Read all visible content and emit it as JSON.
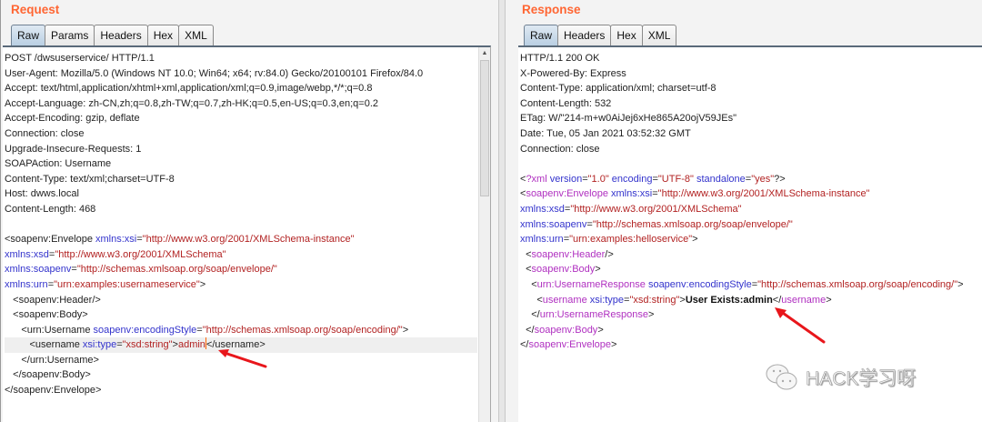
{
  "request": {
    "title": "Request",
    "tabs": [
      {
        "label": "Raw",
        "active": true
      },
      {
        "label": "Params"
      },
      {
        "label": "Headers"
      },
      {
        "label": "Hex"
      },
      {
        "label": "XML"
      }
    ],
    "lines": [
      [
        [
          "t",
          "POST /dwsuserservice/ HTTP/1.1"
        ]
      ],
      [
        [
          "t",
          "User-Agent: Mozilla/5.0 (Windows NT 10.0; Win64; x64; rv:84.0) Gecko/20100101 Firefox/84.0"
        ]
      ],
      [
        [
          "t",
          "Accept: text/html,application/xhtml+xml,application/xml;q=0.9,image/webp,*/*;q=0.8"
        ]
      ],
      [
        [
          "t",
          "Accept-Language: zh-CN,zh;q=0.8,zh-TW;q=0.7,zh-HK;q=0.5,en-US;q=0.3,en;q=0.2"
        ]
      ],
      [
        [
          "t",
          "Accept-Encoding: gzip, deflate"
        ]
      ],
      [
        [
          "t",
          "Connection: close"
        ]
      ],
      [
        [
          "t",
          "Upgrade-Insecure-Requests: 1"
        ]
      ],
      [
        [
          "t",
          "SOAPAction: Username"
        ]
      ],
      [
        [
          "t",
          "Content-Type: text/xml;charset=UTF-8"
        ]
      ],
      [
        [
          "t",
          "Host: dwws.local"
        ]
      ],
      [
        [
          "t",
          "Content-Length: 468"
        ]
      ],
      [
        [
          "t",
          ""
        ]
      ],
      [
        [
          "t",
          "<soapenv:Envelope "
        ],
        [
          "attr",
          "xmlns:xsi"
        ],
        [
          "t",
          "="
        ],
        [
          "val",
          "\"http://www.w3.org/2001/XMLSchema-instance\""
        ]
      ],
      [
        [
          "attr",
          "xmlns:xsd"
        ],
        [
          "t",
          "="
        ],
        [
          "val",
          "\"http://www.w3.org/2001/XMLSchema\""
        ]
      ],
      [
        [
          "attr",
          "xmlns:soapenv"
        ],
        [
          "t",
          "="
        ],
        [
          "val",
          "\"http://schemas.xmlsoap.org/soap/envelope/\""
        ]
      ],
      [
        [
          "attr",
          "xmlns:urn"
        ],
        [
          "t",
          "="
        ],
        [
          "val",
          "\"urn:examples:usernameservice\""
        ],
        [
          "t",
          ">"
        ]
      ],
      [
        [
          "t",
          "   <soapenv:Header/>"
        ]
      ],
      [
        [
          "t",
          "   <soapenv:Body>"
        ]
      ],
      [
        [
          "t",
          "      <urn:Username "
        ],
        [
          "attr",
          "soapenv:encodingStyle"
        ],
        [
          "t",
          "="
        ],
        [
          "val",
          "\"http://schemas.xmlsoap.org/soap/encoding/\""
        ],
        [
          "t",
          ">"
        ]
      ],
      [
        [
          "t",
          "         <username "
        ],
        [
          "attr",
          "xsi:type"
        ],
        [
          "t",
          "="
        ],
        [
          "val",
          "\"xsd:string\""
        ],
        [
          "t",
          ">"
        ],
        [
          "val",
          "admin"
        ],
        [
          "cursor",
          ""
        ],
        [
          "t",
          "</username>"
        ]
      ],
      [
        [
          "t",
          "      </urn:Username>"
        ]
      ],
      [
        [
          "t",
          "   </soapenv:Body>"
        ]
      ],
      [
        [
          "t",
          "</soapenv:Envelope>"
        ]
      ]
    ],
    "highlight_line": 19
  },
  "response": {
    "title": "Response",
    "tabs": [
      {
        "label": "Raw",
        "active": true
      },
      {
        "label": "Headers"
      },
      {
        "label": "Hex"
      },
      {
        "label": "XML"
      }
    ],
    "lines": [
      [
        [
          "t",
          "HTTP/1.1 200 OK"
        ]
      ],
      [
        [
          "t",
          "X-Powered-By: Express"
        ]
      ],
      [
        [
          "t",
          "Content-Type: application/xml; charset=utf-8"
        ]
      ],
      [
        [
          "t",
          "Content-Length: 532"
        ]
      ],
      [
        [
          "t",
          "ETag: W/\"214-m+w0AiJej6xHe865A20ojV59JEs\""
        ]
      ],
      [
        [
          "t",
          "Date: Tue, 05 Jan 2021 03:52:32 GMT"
        ]
      ],
      [
        [
          "t",
          "Connection: close"
        ]
      ],
      [
        [
          "t",
          ""
        ]
      ],
      [
        [
          "t",
          "<"
        ],
        [
          "tagp",
          "?xml"
        ],
        [
          "attr",
          " version"
        ],
        [
          "t",
          "="
        ],
        [
          "val",
          "\"1.0\""
        ],
        [
          "attr",
          " encoding"
        ],
        [
          "t",
          "="
        ],
        [
          "val",
          "\"UTF-8\""
        ],
        [
          "attr",
          " standalone"
        ],
        [
          "t",
          "="
        ],
        [
          "val",
          "\"yes\""
        ],
        [
          "t",
          "?>"
        ]
      ],
      [
        [
          "t",
          "<"
        ],
        [
          "tagp",
          "soapenv:Envelope"
        ],
        [
          "attr",
          " xmlns:xsi"
        ],
        [
          "t",
          "="
        ],
        [
          "val",
          "\"http://www.w3.org/2001/XMLSchema-instance\""
        ]
      ],
      [
        [
          "attr",
          "xmlns:xsd"
        ],
        [
          "t",
          "="
        ],
        [
          "val",
          "\"http://www.w3.org/2001/XMLSchema\""
        ]
      ],
      [
        [
          "attr",
          "xmlns:soapenv"
        ],
        [
          "t",
          "="
        ],
        [
          "val",
          "\"http://schemas.xmlsoap.org/soap/envelope/\""
        ]
      ],
      [
        [
          "attr",
          "xmlns:urn"
        ],
        [
          "t",
          "="
        ],
        [
          "val",
          "\"urn:examples:helloservice\""
        ],
        [
          "t",
          ">"
        ]
      ],
      [
        [
          "t",
          "  <"
        ],
        [
          "tagp",
          "soapenv:Header"
        ],
        [
          "t",
          "/>"
        ]
      ],
      [
        [
          "t",
          "  <"
        ],
        [
          "tagp",
          "soapenv:Body"
        ],
        [
          "t",
          ">"
        ]
      ],
      [
        [
          "t",
          "    <"
        ],
        [
          "tagp",
          "urn:UsernameResponse"
        ],
        [
          "attr",
          " soapenv:encodingStyle"
        ],
        [
          "t",
          "="
        ],
        [
          "val",
          "\"http://schemas.xmlsoap.org/soap/encoding/\""
        ],
        [
          "t",
          ">"
        ]
      ],
      [
        [
          "t",
          "      <"
        ],
        [
          "tagp",
          "username"
        ],
        [
          "attr",
          " xsi:type"
        ],
        [
          "t",
          "="
        ],
        [
          "val",
          "\"xsd:string\""
        ],
        [
          "t",
          ">"
        ],
        [
          "bold",
          "User Exists:admin"
        ],
        [
          "t",
          "</"
        ],
        [
          "tagp",
          "username"
        ],
        [
          "t",
          ">"
        ]
      ],
      [
        [
          "t",
          "    </"
        ],
        [
          "tagp",
          "urn:UsernameResponse"
        ],
        [
          "t",
          ">"
        ]
      ],
      [
        [
          "t",
          "  </"
        ],
        [
          "tagp",
          "soapenv:Body"
        ],
        [
          "t",
          ">"
        ]
      ],
      [
        [
          "t",
          "</"
        ],
        [
          "tagp",
          "soapenv:Envelope"
        ],
        [
          "t",
          ">"
        ]
      ]
    ]
  },
  "watermark": {
    "text": "HACK学习呀",
    "icon": "wechat-icon"
  },
  "colors": {
    "title": "#ff6633",
    "attr": "#3333cc",
    "value": "#b22222",
    "tag": "#b030c0",
    "arrow": "#e8161b"
  }
}
